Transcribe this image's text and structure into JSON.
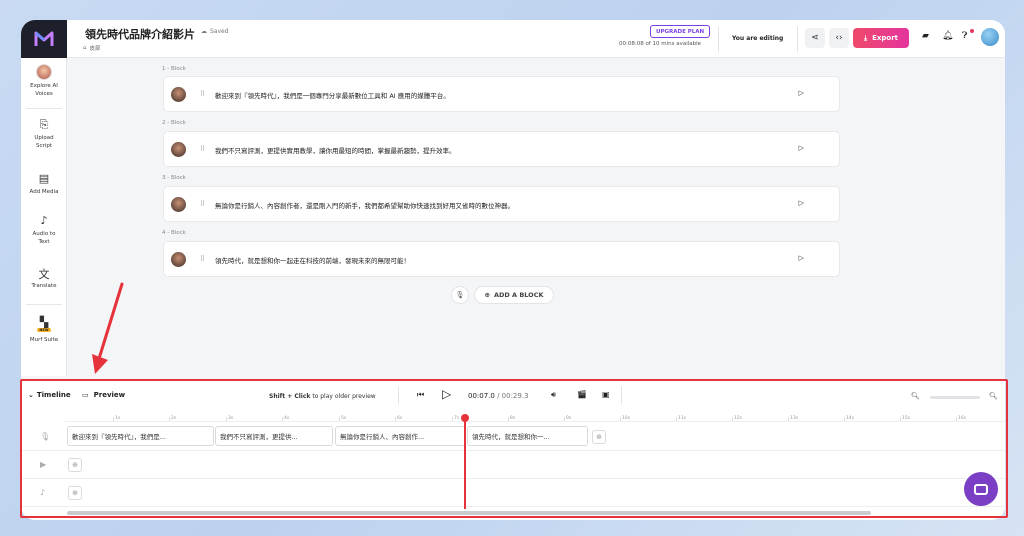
{
  "header": {
    "project_title": "領先時代品牌介紹影片",
    "saved_status": "Saved",
    "breadcrumb": "皮部",
    "upgrade_label": "UPGRADE PLAN",
    "minutes_available": "00:08:08 of 10 mins available",
    "editing_status": "You are editing",
    "export_label": "Export"
  },
  "sidebar": {
    "items": [
      {
        "label": "Explore AI Voices"
      },
      {
        "label": "Upload Script"
      },
      {
        "label": "Add Media"
      },
      {
        "label": "Audio to Text"
      },
      {
        "label": "Translate"
      },
      {
        "label": "Murf Suite",
        "badge": "NEW"
      }
    ]
  },
  "blocks": [
    {
      "num": "1 -  Block",
      "text": "歡迎來到『領先時代』，我們是一個專門分享最新數位工具和 AI 應用的媒體平台。"
    },
    {
      "num": "2 -  Block",
      "text": "我們不只寫評測，更提供實用教學，讓你用最短的時間，掌握最新趨勢，提升效率。"
    },
    {
      "num": "3 -  Block",
      "text": "無論你是行銷人、內容創作者，還是剛入門的新手，我們都希望幫助你快速找到好用又省時的數位神器。"
    },
    {
      "num": "4 -  Block",
      "text": "領先時代，就是想和你一起走在科技的前端，發現未來的無限可能！"
    }
  ],
  "add_block_label": "ADD A BLOCK",
  "timeline": {
    "toggle_label": "Timeline",
    "preview_label": "Preview",
    "hint_bold": "Shift + Click",
    "hint_rest": " to play older preview",
    "current_time": "00:07.0",
    "total_time": " / 00:29.3",
    "ruler_ticks": [
      "1s",
      "2s",
      "3s",
      "4s",
      "5s",
      "6s",
      "7s",
      "8s",
      "9s",
      "10s",
      "11s",
      "12s",
      "13s",
      "14s",
      "15s",
      "16s"
    ],
    "clips": [
      "歡迎來到『領先時代』，我們是...",
      "我們不只寫評測，更提供...",
      "無論你是行銷人、內容創作...",
      "領先時代，就是想和你一..."
    ]
  },
  "colors": {
    "accent": "#7b3fe4",
    "export_start": "#ef4a6a",
    "export_end": "#e4349e",
    "highlight_red": "#e5333b",
    "chat": "#7a3fc4"
  },
  "icons": {
    "logo": "murf-logo-icon",
    "share": "share-icon",
    "embed": "code-icon",
    "comments": "comment-icon",
    "notifications": "bell-icon",
    "help": "help-icon",
    "chat": "chat-icon"
  }
}
